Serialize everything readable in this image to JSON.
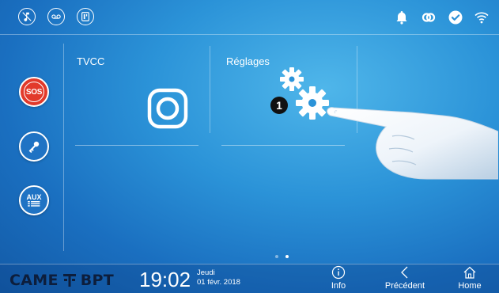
{
  "topbar": {
    "left_icons": [
      "music-mute-icon",
      "voicemail-icon",
      "intercom-icon"
    ],
    "right_icons": [
      "bell-icon",
      "link-icon",
      "check-icon",
      "wifi-icon"
    ]
  },
  "sidebar": {
    "sos_label": "SOS",
    "key_icon": "key-icon",
    "aux_label": "AUX"
  },
  "tiles": [
    {
      "label": "TVCC",
      "icon": "camera-icon"
    },
    {
      "label": "Réglages",
      "icon": "gear-icon"
    }
  ],
  "annotation": {
    "badge": "1"
  },
  "pager": {
    "pages": 2,
    "current": 2
  },
  "footer": {
    "brand_left": "CAME",
    "brand_right": "BPT",
    "time": "19:02",
    "day": "Jeudi",
    "date": "01 févr. 2018",
    "info_label": "Info",
    "back_label": "Précédent",
    "home_label": "Home"
  },
  "colors": {
    "sos_red": "#e23a2b",
    "accent_blue": "#1f73c4",
    "brand_dark": "#0d1e3c"
  }
}
